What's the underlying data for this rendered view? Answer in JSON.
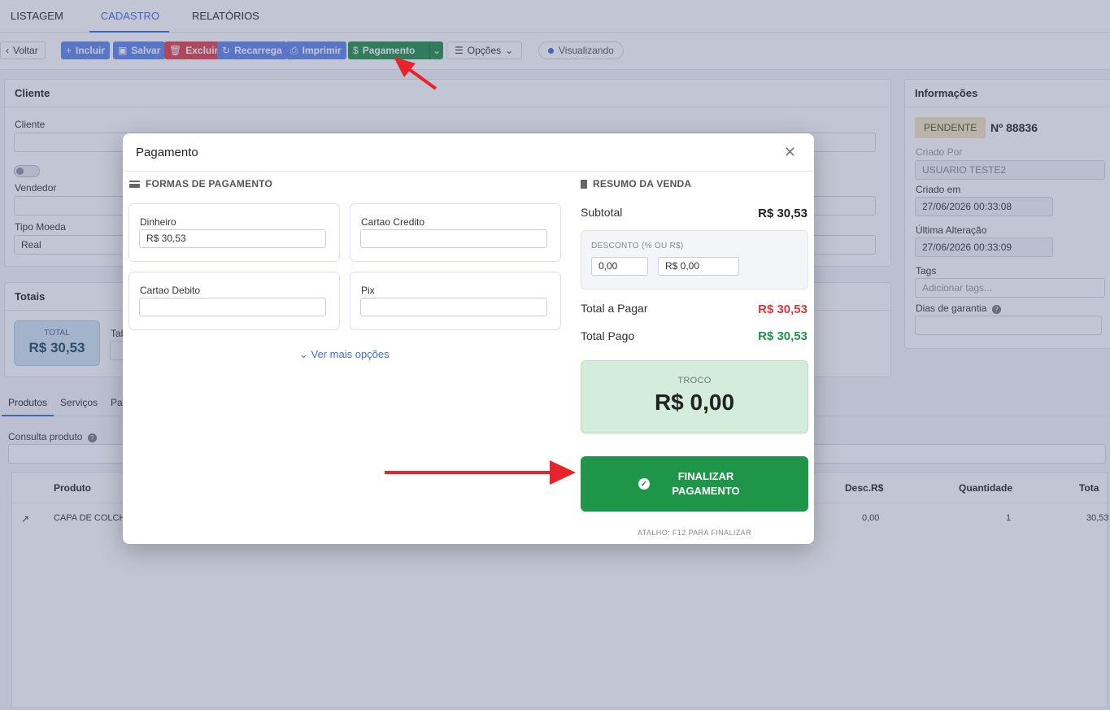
{
  "top_tabs": [
    "LISTAGEM",
    "CADASTRO",
    "RELATÓRIOS"
  ],
  "toolbar": {
    "back": "Voltar",
    "include": "Incluir",
    "save": "Salvar",
    "delete": "Excluir",
    "reload": "Recarrega",
    "print": "Imprimir",
    "payment": "Pagamento",
    "options": "Opções",
    "status": "Visualizando"
  },
  "client_panel": {
    "title": "Cliente",
    "client_label": "Cliente",
    "seller_label": "Vendedor",
    "currency_label": "Tipo Moeda",
    "currency_value": "Real"
  },
  "totals_panel": {
    "title": "Totais",
    "total_label": "TOTAL",
    "total_value": "R$ 30,53",
    "tab_label": "Tab"
  },
  "info_panel": {
    "title": "Informações",
    "status_badge": "PENDENTE",
    "order_number": "Nº 88836",
    "created_by_label": "Criado Por",
    "created_by_value": "USUARIO TESTE2",
    "created_at_label": "Criado em",
    "created_at_value": "27/06/2026 00:33:08",
    "updated_at_label": "Última Alteração",
    "updated_at_value": "27/06/2026 00:33:09",
    "tags_label": "Tags",
    "tags_placeholder": "Adicionar tags...",
    "warranty_label": "Dias de garantia"
  },
  "sub_tabs": [
    "Produtos",
    "Serviços",
    "Pag"
  ],
  "product_search_label": "Consulta produto",
  "grid": {
    "headers": {
      "product": "Produto",
      "discount": "Desc.R$",
      "quantity": "Quantidade",
      "total": "Tota"
    },
    "rows": [
      {
        "product": "CAPA DE COLCH",
        "discount": "0,00",
        "quantity": "1",
        "total": "30,53"
      }
    ]
  },
  "modal": {
    "title": "Pagamento",
    "payment_methods_title": "FORMAS DE PAGAMENTO",
    "methods": [
      {
        "label": "Dinheiro",
        "value": "R$ 30,53"
      },
      {
        "label": "Cartao Credito",
        "value": ""
      },
      {
        "label": "Cartao Debito",
        "value": ""
      },
      {
        "label": "Pix",
        "value": ""
      }
    ],
    "see_more": "Ver mais opções",
    "summary_title": "RESUMO DA VENDA",
    "subtotal_label": "Subtotal",
    "subtotal_value": "R$ 30,53",
    "discount_label": "DESCONTO (% OU R$)",
    "discount_percent": "0,00",
    "discount_amount": "R$ 0,00",
    "total_to_pay_label": "Total a Pagar",
    "total_to_pay_value": "R$ 30,53",
    "total_paid_label": "Total Pago",
    "total_paid_value": "R$ 30,53",
    "change_label": "TROCO",
    "change_value": "R$ 0,00",
    "finish_label": "FINALIZAR PAGAMENTO",
    "shortcut_hint": "ATALHO: F12 PARA FINALIZAR"
  },
  "colors": {
    "accent": "#3d6be0",
    "green": "#1e9549",
    "red": "#d9363e",
    "annotation_arrow": "#e5252b"
  }
}
